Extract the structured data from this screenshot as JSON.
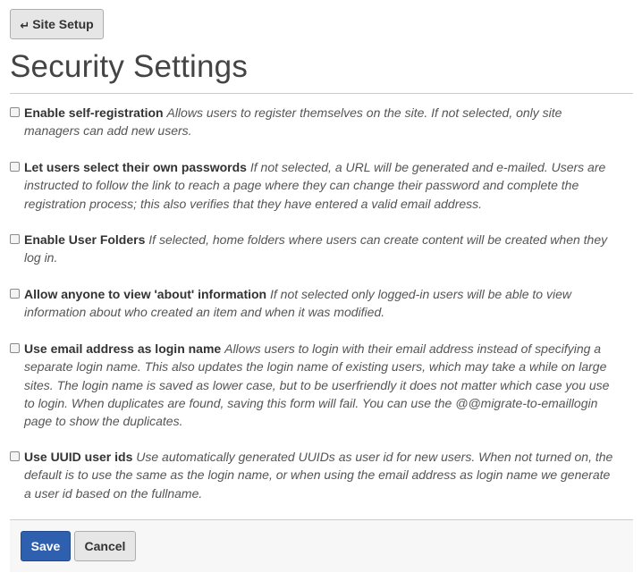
{
  "header": {
    "back_button": {
      "label": "Site Setup",
      "icon": "return-arrow-icon"
    },
    "title": "Security Settings"
  },
  "fields": [
    {
      "label": "Enable self-registration",
      "help": "Allows users to register themselves on the site. If not selected, only site managers can add new users.",
      "checked": false
    },
    {
      "label": "Let users select their own passwords",
      "help": "If not selected, a URL will be generated and e-mailed. Users are instructed to follow the link to reach a page where they can change their password and complete the registration process; this also verifies that they have entered a valid email address.",
      "checked": false
    },
    {
      "label": "Enable User Folders",
      "help": "If selected, home folders where users can create content will be created when they log in.",
      "checked": false
    },
    {
      "label": "Allow anyone to view 'about' information",
      "help": "If not selected only logged-in users will be able to view information about who created an item and when it was modified.",
      "checked": false
    },
    {
      "label": "Use email address as login name",
      "help": "Allows users to login with their email address instead of specifying a separate login name. This also updates the login name of existing users, which may take a while on large sites. The login name is saved as lower case, but to be userfriendly it does not matter which case you use to login. When duplicates are found, saving this form will fail. You can use the @@migrate-to-emaillogin page to show the duplicates.",
      "checked": false
    },
    {
      "label": "Use UUID user ids",
      "help": "Use automatically generated UUIDs as user id for new users. When not turned on, the default is to use the same as the login name, or when using the email address as login name we generate a user id based on the fullname.",
      "checked": false
    }
  ],
  "actions": {
    "save_label": "Save",
    "cancel_label": "Cancel"
  },
  "colors": {
    "primary_button": "#2f5faf",
    "default_button": "#e6e6e6",
    "rule": "#cccccc"
  }
}
